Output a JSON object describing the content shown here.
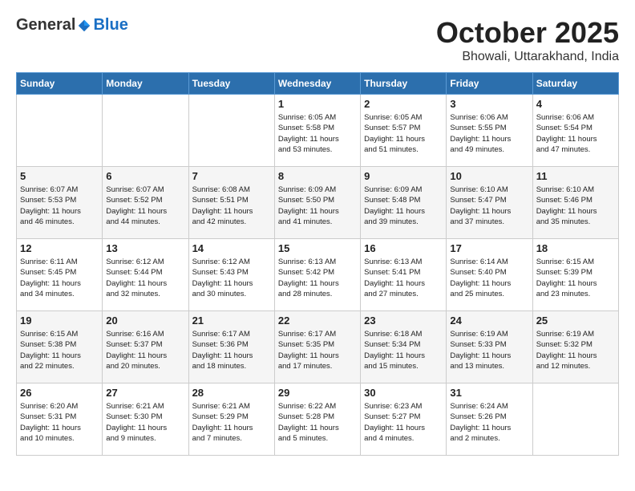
{
  "header": {
    "logo": {
      "general": "General",
      "blue": "Blue"
    },
    "month": "October 2025",
    "location": "Bhowali, Uttarakhand, India"
  },
  "weekdays": [
    "Sunday",
    "Monday",
    "Tuesday",
    "Wednesday",
    "Thursday",
    "Friday",
    "Saturday"
  ],
  "weeks": [
    [
      {
        "day": "",
        "info": ""
      },
      {
        "day": "",
        "info": ""
      },
      {
        "day": "",
        "info": ""
      },
      {
        "day": "1",
        "info": "Sunrise: 6:05 AM\nSunset: 5:58 PM\nDaylight: 11 hours\nand 53 minutes."
      },
      {
        "day": "2",
        "info": "Sunrise: 6:05 AM\nSunset: 5:57 PM\nDaylight: 11 hours\nand 51 minutes."
      },
      {
        "day": "3",
        "info": "Sunrise: 6:06 AM\nSunset: 5:55 PM\nDaylight: 11 hours\nand 49 minutes."
      },
      {
        "day": "4",
        "info": "Sunrise: 6:06 AM\nSunset: 5:54 PM\nDaylight: 11 hours\nand 47 minutes."
      }
    ],
    [
      {
        "day": "5",
        "info": "Sunrise: 6:07 AM\nSunset: 5:53 PM\nDaylight: 11 hours\nand 46 minutes."
      },
      {
        "day": "6",
        "info": "Sunrise: 6:07 AM\nSunset: 5:52 PM\nDaylight: 11 hours\nand 44 minutes."
      },
      {
        "day": "7",
        "info": "Sunrise: 6:08 AM\nSunset: 5:51 PM\nDaylight: 11 hours\nand 42 minutes."
      },
      {
        "day": "8",
        "info": "Sunrise: 6:09 AM\nSunset: 5:50 PM\nDaylight: 11 hours\nand 41 minutes."
      },
      {
        "day": "9",
        "info": "Sunrise: 6:09 AM\nSunset: 5:48 PM\nDaylight: 11 hours\nand 39 minutes."
      },
      {
        "day": "10",
        "info": "Sunrise: 6:10 AM\nSunset: 5:47 PM\nDaylight: 11 hours\nand 37 minutes."
      },
      {
        "day": "11",
        "info": "Sunrise: 6:10 AM\nSunset: 5:46 PM\nDaylight: 11 hours\nand 35 minutes."
      }
    ],
    [
      {
        "day": "12",
        "info": "Sunrise: 6:11 AM\nSunset: 5:45 PM\nDaylight: 11 hours\nand 34 minutes."
      },
      {
        "day": "13",
        "info": "Sunrise: 6:12 AM\nSunset: 5:44 PM\nDaylight: 11 hours\nand 32 minutes."
      },
      {
        "day": "14",
        "info": "Sunrise: 6:12 AM\nSunset: 5:43 PM\nDaylight: 11 hours\nand 30 minutes."
      },
      {
        "day": "15",
        "info": "Sunrise: 6:13 AM\nSunset: 5:42 PM\nDaylight: 11 hours\nand 28 minutes."
      },
      {
        "day": "16",
        "info": "Sunrise: 6:13 AM\nSunset: 5:41 PM\nDaylight: 11 hours\nand 27 minutes."
      },
      {
        "day": "17",
        "info": "Sunrise: 6:14 AM\nSunset: 5:40 PM\nDaylight: 11 hours\nand 25 minutes."
      },
      {
        "day": "18",
        "info": "Sunrise: 6:15 AM\nSunset: 5:39 PM\nDaylight: 11 hours\nand 23 minutes."
      }
    ],
    [
      {
        "day": "19",
        "info": "Sunrise: 6:15 AM\nSunset: 5:38 PM\nDaylight: 11 hours\nand 22 minutes."
      },
      {
        "day": "20",
        "info": "Sunrise: 6:16 AM\nSunset: 5:37 PM\nDaylight: 11 hours\nand 20 minutes."
      },
      {
        "day": "21",
        "info": "Sunrise: 6:17 AM\nSunset: 5:36 PM\nDaylight: 11 hours\nand 18 minutes."
      },
      {
        "day": "22",
        "info": "Sunrise: 6:17 AM\nSunset: 5:35 PM\nDaylight: 11 hours\nand 17 minutes."
      },
      {
        "day": "23",
        "info": "Sunrise: 6:18 AM\nSunset: 5:34 PM\nDaylight: 11 hours\nand 15 minutes."
      },
      {
        "day": "24",
        "info": "Sunrise: 6:19 AM\nSunset: 5:33 PM\nDaylight: 11 hours\nand 13 minutes."
      },
      {
        "day": "25",
        "info": "Sunrise: 6:19 AM\nSunset: 5:32 PM\nDaylight: 11 hours\nand 12 minutes."
      }
    ],
    [
      {
        "day": "26",
        "info": "Sunrise: 6:20 AM\nSunset: 5:31 PM\nDaylight: 11 hours\nand 10 minutes."
      },
      {
        "day": "27",
        "info": "Sunrise: 6:21 AM\nSunset: 5:30 PM\nDaylight: 11 hours\nand 9 minutes."
      },
      {
        "day": "28",
        "info": "Sunrise: 6:21 AM\nSunset: 5:29 PM\nDaylight: 11 hours\nand 7 minutes."
      },
      {
        "day": "29",
        "info": "Sunrise: 6:22 AM\nSunset: 5:28 PM\nDaylight: 11 hours\nand 5 minutes."
      },
      {
        "day": "30",
        "info": "Sunrise: 6:23 AM\nSunset: 5:27 PM\nDaylight: 11 hours\nand 4 minutes."
      },
      {
        "day": "31",
        "info": "Sunrise: 6:24 AM\nSunset: 5:26 PM\nDaylight: 11 hours\nand 2 minutes."
      },
      {
        "day": "",
        "info": ""
      }
    ]
  ]
}
